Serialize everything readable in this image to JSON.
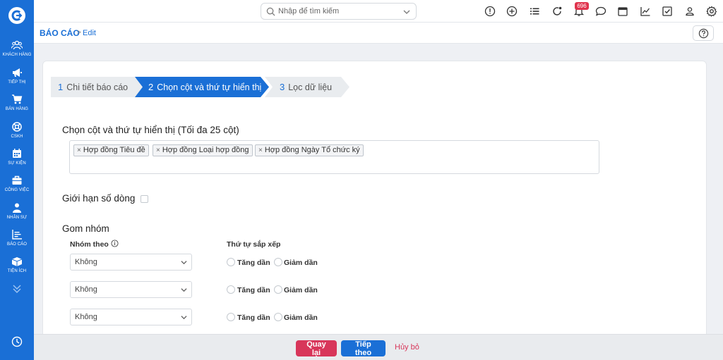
{
  "sidebar": {
    "items": [
      {
        "label": "KHÁCH HÀNG",
        "icon": "users-icon"
      },
      {
        "label": "TIẾP THỊ",
        "icon": "megaphone-icon"
      },
      {
        "label": "BÁN HÀNG",
        "icon": "cart-icon"
      },
      {
        "label": "CSKH",
        "icon": "lifebuoy-icon"
      },
      {
        "label": "SỰ KIỆN",
        "icon": "calendar-icon"
      },
      {
        "label": "CÔNG VIỆC",
        "icon": "briefcase-icon"
      },
      {
        "label": "NHÂN SỰ",
        "icon": "person-icon"
      },
      {
        "label": "BÁO CÁO",
        "icon": "report-chart-icon"
      },
      {
        "label": "TIỆN ÍCH",
        "icon": "box-icon"
      }
    ]
  },
  "topbar": {
    "search_placeholder": "Nhập để tìm kiếm",
    "notification_count": "696"
  },
  "breadcrumb": {
    "root": "BÁO CÁO",
    "separator": ">",
    "current": "Edit"
  },
  "steps": [
    {
      "num": "1",
      "label": "Chi tiết báo cáo"
    },
    {
      "num": "2",
      "label": "Chọn cột và thứ tự hiển thị"
    },
    {
      "num": "3",
      "label": "Lọc dữ liệu"
    }
  ],
  "columns_section": {
    "title": "Chọn cột và thứ tự hiển thị (Tối đa 25 cột)",
    "tags": [
      "Hợp đồng Tiêu đề",
      "Hợp đồng Loại hợp đồng",
      "Hợp đồng Ngày Tổ chức ký"
    ],
    "remove_glyph": "×"
  },
  "limit_rows_label": "Giới hạn số dòng",
  "group_section": {
    "title": "Gom nhóm",
    "group_by_label": "Nhóm theo",
    "sort_order_label": "Thứ tự sắp xếp",
    "rows": [
      {
        "value": "Không",
        "asc": "Tăng dần",
        "desc": "Giảm dần"
      },
      {
        "value": "Không",
        "asc": "Tăng dần",
        "desc": "Giảm dần"
      },
      {
        "value": "Không",
        "asc": "Tăng dần",
        "desc": "Giảm dần"
      }
    ]
  },
  "footer": {
    "back_label": "Quay lại",
    "next_label": "Tiếp theo",
    "cancel_label": "Hủy bỏ"
  },
  "colors": {
    "brand": "#1a6fd6",
    "danger": "#d8365a",
    "badge": "#e0334d"
  }
}
